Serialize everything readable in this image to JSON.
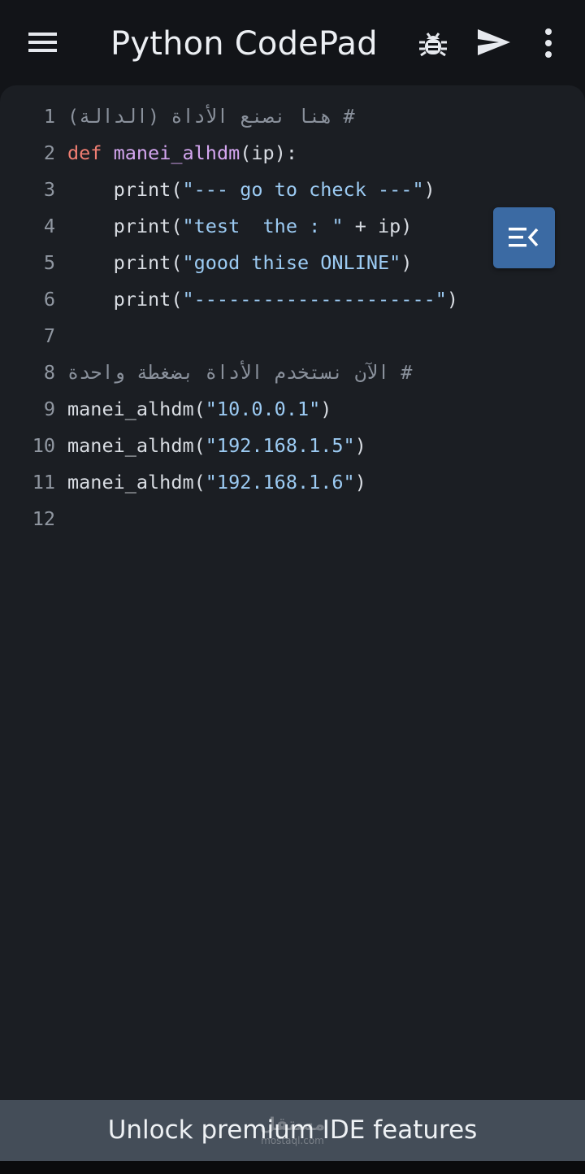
{
  "appbar": {
    "title": "Python CodePad",
    "icons": {
      "menu": "menu-icon",
      "debug": "bug-icon",
      "run": "send-icon",
      "more": "more-vertical-icon"
    }
  },
  "editor": {
    "lines": [
      {
        "n": "1",
        "tokens": [
          {
            "t": "# هنا نصنع الأداة (الدالة)",
            "c": "comment"
          }
        ]
      },
      {
        "n": "2",
        "tokens": [
          {
            "t": "def",
            "c": "kw"
          },
          {
            "t": " ",
            "c": "plain"
          },
          {
            "t": "manei_alhdm",
            "c": "fn"
          },
          {
            "t": "(ip):",
            "c": "plain"
          }
        ]
      },
      {
        "n": "3",
        "tokens": [
          {
            "t": "    print(",
            "c": "plain"
          },
          {
            "t": "\"--- go to check ---\"",
            "c": "str"
          },
          {
            "t": ")",
            "c": "plain"
          }
        ]
      },
      {
        "n": "4",
        "tokens": [
          {
            "t": "    print(",
            "c": "plain"
          },
          {
            "t": "\"test  the : \"",
            "c": "str"
          },
          {
            "t": " + ip)",
            "c": "plain"
          }
        ]
      },
      {
        "n": "5",
        "tokens": [
          {
            "t": "    print(",
            "c": "plain"
          },
          {
            "t": "\"good thise ONLINE\"",
            "c": "str"
          },
          {
            "t": ")",
            "c": "plain"
          }
        ]
      },
      {
        "n": "6",
        "tokens": [
          {
            "t": "    print(",
            "c": "plain"
          },
          {
            "t": "\"---------------------\"",
            "c": "str"
          },
          {
            "t": ")",
            "c": "plain"
          }
        ]
      },
      {
        "n": "7",
        "tokens": []
      },
      {
        "n": "8",
        "tokens": [
          {
            "t": "# الآن نستخدم الأداة بضغطة واحدة",
            "c": "comment"
          }
        ]
      },
      {
        "n": "9",
        "tokens": [
          {
            "t": "manei_alhdm(",
            "c": "plain"
          },
          {
            "t": "\"10.0.0.1\"",
            "c": "str"
          },
          {
            "t": ")",
            "c": "plain"
          }
        ]
      },
      {
        "n": "10",
        "tokens": [
          {
            "t": "manei_alhdm(",
            "c": "plain"
          },
          {
            "t": "\"192.168.1.5\"",
            "c": "str"
          },
          {
            "t": ")",
            "c": "plain"
          }
        ]
      },
      {
        "n": "11",
        "tokens": [
          {
            "t": "manei_alhdm(",
            "c": "plain"
          },
          {
            "t": "\"192.168.1.6\"",
            "c": "str"
          },
          {
            "t": ")",
            "c": "plain"
          }
        ]
      },
      {
        "n": "12",
        "tokens": []
      }
    ],
    "fab_icon": "collapse-panel-icon"
  },
  "banner": {
    "text": "Unlock premium IDE features",
    "watermark_ar": "مستقل",
    "watermark_en": "mostaql.com"
  },
  "colors": {
    "background": "#121418",
    "editor_bg": "#1B1E23",
    "comment": "#8A919C",
    "keyword": "#F07E72",
    "function": "#D4A6F0",
    "string": "#9CCBF3",
    "plain": "#D8DCE2",
    "fab": "#3B6AA3",
    "banner": "#444D58"
  }
}
